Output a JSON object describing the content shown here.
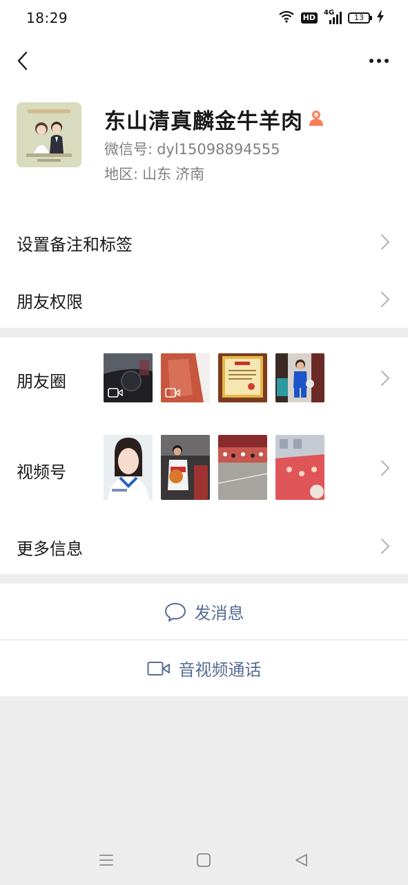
{
  "status_bar": {
    "time": "18:29",
    "hd_label": "HD",
    "network_label": "4G",
    "battery": "13",
    "icons": [
      "wifi-icon",
      "hd-icon",
      "signal-icon",
      "battery-icon",
      "charging-icon"
    ]
  },
  "nav": {
    "back_icon": "chevron-left-icon",
    "more_icon": "more-dots-icon"
  },
  "profile": {
    "nickname": "东山清真麟金牛羊肉",
    "wechat_id_label": "微信号:",
    "wechat_id": "dyl15098894555",
    "region_label": "地区:",
    "region_province": "山东",
    "region_city": "济南",
    "gender_icon": "person-icon"
  },
  "menu": {
    "remarks_tags": "设置备注和标签",
    "friend_permissions": "朋友权限",
    "moments": "朋友圈",
    "channels": "视频号",
    "more_info": "更多信息"
  },
  "actions": {
    "send_message": "发消息",
    "voice_video_call": "音视频通话"
  },
  "colors": {
    "link_blue": "#576b95",
    "background_gray": "#ededed",
    "gender_badge": "#fa7d5a"
  }
}
